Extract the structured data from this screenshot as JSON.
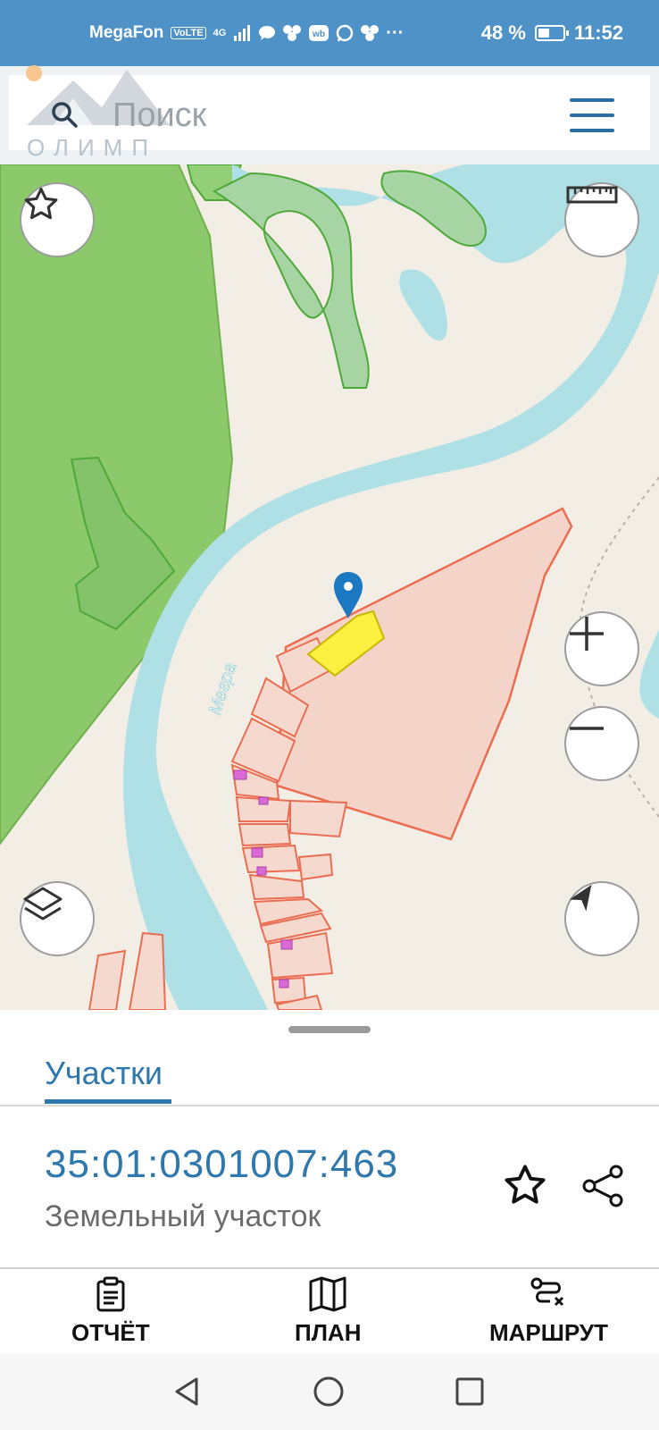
{
  "status_bar": {
    "carrier": "MegaFon",
    "volte": "VoLTE",
    "network": "4G",
    "more": "···",
    "battery_percent": 48,
    "battery_text": "48 %",
    "time": "11:52"
  },
  "search": {
    "placeholder": "Поиск",
    "logo_text": "ОЛИМП",
    "icons": [
      "search-icon",
      "menu-icon"
    ]
  },
  "map": {
    "river_label": "Мегра",
    "buttons": [
      "favorite-star",
      "ruler",
      "zoom-in",
      "zoom-out",
      "layers",
      "locate"
    ],
    "colors": {
      "forest": "#8cc96b",
      "water": "#aee0e6",
      "background": "#f2ede5",
      "parcel_fill": "#f4d4c9",
      "parcel_stroke": "#ea6d51",
      "selected_parcel": "#fbf03f",
      "marker": "#1c78c0"
    }
  },
  "sheet": {
    "tab_label": "Участки",
    "cadastral_number": "35:01:0301007:463",
    "parcel_type": "Земельный участок"
  },
  "bottom_nav": {
    "items": [
      {
        "label": "ОТЧЁТ",
        "icon": "report-icon"
      },
      {
        "label": "ПЛАН",
        "icon": "map-icon"
      },
      {
        "label": "МАРШРУТ",
        "icon": "route-icon"
      }
    ]
  },
  "system_nav": [
    "back",
    "home",
    "recents"
  ]
}
